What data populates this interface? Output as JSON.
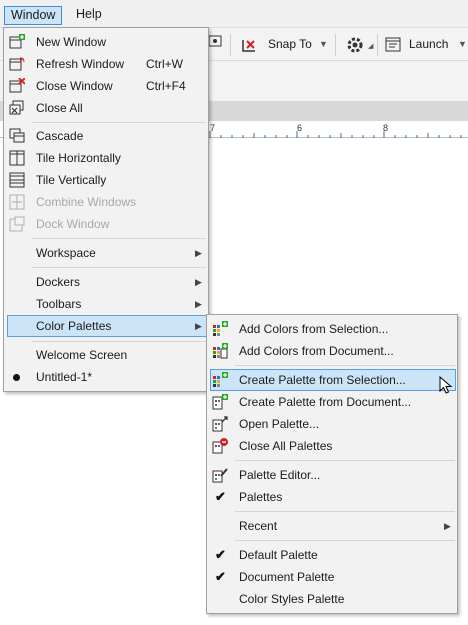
{
  "menubar": {
    "window": "Window",
    "help": "Help"
  },
  "toolbar": {
    "snap_to": "Snap To",
    "launch": "Launch"
  },
  "ruler": {
    "ticks": [
      "7",
      "6",
      "8"
    ]
  },
  "window_menu": {
    "new_window": "New Window",
    "refresh_window": "Refresh Window",
    "refresh_shortcut": "Ctrl+W",
    "close_window": "Close Window",
    "close_shortcut": "Ctrl+F4",
    "close_all": "Close All",
    "cascade": "Cascade",
    "tile_horizontally": "Tile Horizontally",
    "tile_vertically": "Tile Vertically",
    "combine_windows": "Combine Windows",
    "dock_window": "Dock Window",
    "workspace": "Workspace",
    "dockers": "Dockers",
    "toolbars": "Toolbars",
    "color_palettes": "Color Palettes",
    "welcome_screen": "Welcome Screen",
    "untitled": "Untitled-1*"
  },
  "palettes_menu": {
    "add_from_selection": "Add Colors from Selection...",
    "add_from_document": "Add Colors from Document...",
    "create_from_selection": "Create Palette from Selection...",
    "create_from_document": "Create Palette from Document...",
    "open_palette": "Open Palette...",
    "close_all_palettes": "Close All Palettes",
    "palette_editor": "Palette Editor...",
    "palettes": "Palettes",
    "recent": "Recent",
    "default_palette": "Default Palette",
    "document_palette": "Document Palette",
    "color_styles_palette": "Color Styles Palette"
  },
  "colors": {
    "highlight": "#cce4f7",
    "highlight_border": "#5aa0e0",
    "menu_bg": "#f2f2f2",
    "icon_green": "#2aa52a",
    "icon_red": "#d62020"
  }
}
